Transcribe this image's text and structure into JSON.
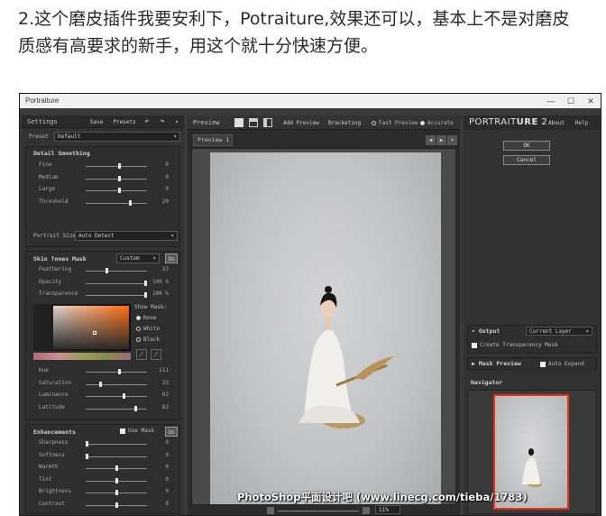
{
  "caption": {
    "line1": "2.这个磨皮插件我要安利下，Potraiture,效果还可以，基本上不是对磨皮",
    "line2": "质感有高要求的新手，用这个就十分快速方便。"
  },
  "window": {
    "title": "Portraiture",
    "min": "—",
    "max": "☐",
    "close": "✕"
  },
  "left": {
    "settings_label": "Settings",
    "save": "Save",
    "presets": "Presets",
    "undo": "↶",
    "redo": "↷",
    "more": "▾",
    "preset_label": "Preset",
    "preset_value": "Default",
    "detail": {
      "title": "Detail Smoothing",
      "rows": [
        {
          "label": "Fine",
          "value": "0",
          "pos": 0.55
        },
        {
          "label": "Medium",
          "value": "0",
          "pos": 0.55
        },
        {
          "label": "Large",
          "value": "0",
          "pos": 0.55
        },
        {
          "label": "Threshold",
          "value": "20",
          "pos": 0.72
        }
      ],
      "portrait_size_label": "Portrait Size",
      "portrait_size_value": "Auto Detect"
    },
    "skin": {
      "title": "Skin Tones Mask",
      "mode": "Custom",
      "ok": "On",
      "rows": [
        {
          "label": "Feathering",
          "value": "33",
          "pos": 0.33
        },
        {
          "label": "Opacity",
          "value": "100 %",
          "pos": 0.98
        },
        {
          "label": "Transparence",
          "value": "100 %",
          "pos": 0.98
        }
      ],
      "show_mask_label": "Show Mask:",
      "mask_options": [
        "None",
        "White",
        "Black"
      ],
      "hsl": [
        {
          "label": "Hue",
          "value": "111",
          "pos": 0.55
        },
        {
          "label": "Saturation",
          "value": "23",
          "pos": 0.23
        },
        {
          "label": "Luminance",
          "value": "62",
          "pos": 0.62
        },
        {
          "label": "Latitude",
          "value": "82",
          "pos": 0.82
        }
      ]
    },
    "enh": {
      "title": "Enhancements",
      "use_mask": "Use Mask",
      "ok": "On",
      "rows": [
        {
          "label": "Sharpness",
          "value": "0",
          "pos": 0.0
        },
        {
          "label": "Softness",
          "value": "0",
          "pos": 0.0
        },
        {
          "label": "Warmth",
          "value": "0",
          "pos": 0.5
        },
        {
          "label": "Tint",
          "value": "0",
          "pos": 0.5
        },
        {
          "label": "Brightness",
          "value": "0",
          "pos": 0.5
        },
        {
          "label": "Contrast",
          "value": "0",
          "pos": 0.5
        }
      ]
    }
  },
  "center": {
    "preview_label": "Preview",
    "add_preview": "Add Preview",
    "bracketing": "Bracketing",
    "fast_preview": "Fast Preview",
    "accurate": "Accurate",
    "tab": "Preview 1",
    "zoom": "11%"
  },
  "right": {
    "brand_a": "PORTRAIT",
    "brand_b": "URE",
    "version": "2",
    "about": "About",
    "help": "Help",
    "ok": "OK",
    "cancel": "Cancel",
    "output_label": "Output",
    "output_value": "Current Layer",
    "create_transparency": "Create Transparency Mask",
    "mask_preview": "Mask Preview",
    "auto_expand": "Auto Expand",
    "navigator": "Navigator"
  },
  "watermark": "PhotoShop平面设计吧 (www.linecg.com/tieba/1783)"
}
